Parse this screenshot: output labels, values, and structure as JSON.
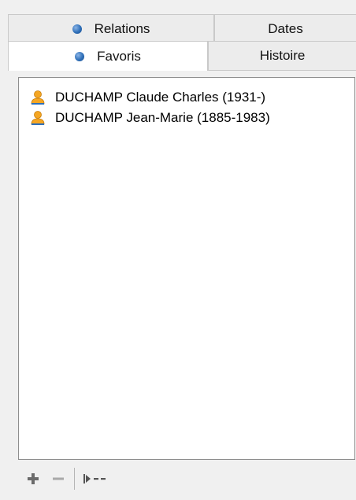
{
  "tabs": {
    "back_row": [
      {
        "label": "Relations",
        "has_bullet": true
      },
      {
        "label": "Dates",
        "has_bullet": false
      }
    ],
    "front_row": [
      {
        "label": "Favoris",
        "has_bullet": true,
        "selected": true
      },
      {
        "label": "Histoire",
        "has_bullet": false
      }
    ]
  },
  "favorites": {
    "items": [
      {
        "label": "DUCHAMP Claude Charles (1931-)",
        "icon": "person-icon"
      },
      {
        "label": "DUCHAMP Jean-Marie (1885-1983)",
        "icon": "person-icon"
      }
    ]
  },
  "toolbar": {
    "buttons": [
      {
        "icon": "add-icon"
      },
      {
        "icon": "remove-icon"
      },
      {
        "icon": "go-to-icon"
      }
    ]
  },
  "colors": {
    "person_icon": "#f5a623",
    "bullet": "#2f6fb8",
    "toolbar_icon": "#6b6b6b"
  }
}
